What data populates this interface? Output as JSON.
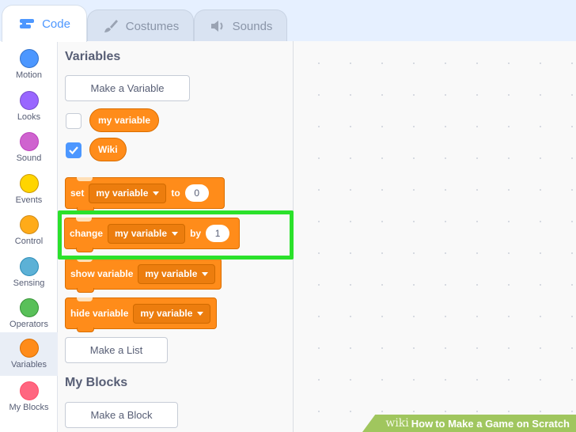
{
  "tabs": [
    {
      "label": "Code",
      "icon": "code-icon",
      "active": true
    },
    {
      "label": "Costumes",
      "icon": "brush-icon",
      "active": false
    },
    {
      "label": "Sounds",
      "icon": "speaker-icon",
      "active": false
    }
  ],
  "categories": [
    {
      "label": "Motion",
      "color": "#4c97ff"
    },
    {
      "label": "Looks",
      "color": "#9966ff"
    },
    {
      "label": "Sound",
      "color": "#cf63cf"
    },
    {
      "label": "Events",
      "color": "#ffd500"
    },
    {
      "label": "Control",
      "color": "#ffab19"
    },
    {
      "label": "Sensing",
      "color": "#5cb1d6"
    },
    {
      "label": "Operators",
      "color": "#59c059"
    },
    {
      "label": "Variables",
      "color": "#ff8c1a",
      "selected": true
    },
    {
      "label": "My Blocks",
      "color": "#ff6680"
    }
  ],
  "palette": {
    "variables_title": "Variables",
    "make_variable": "Make a Variable",
    "variables": [
      {
        "name": "my variable",
        "checked": false
      },
      {
        "name": "Wiki",
        "checked": true
      }
    ],
    "set_block": {
      "keyword": "set",
      "dropdown": "my variable",
      "to": "to",
      "value": "0"
    },
    "change_block": {
      "keyword": "change",
      "dropdown": "my variable",
      "by": "by",
      "value": "1"
    },
    "show_block": {
      "keyword": "show variable",
      "dropdown": "my variable"
    },
    "hide_block": {
      "keyword": "hide variable",
      "dropdown": "my variable"
    },
    "make_list": "Make a List",
    "myblocks_title": "My Blocks",
    "make_block": "Make a Block"
  },
  "watermark": {
    "wiki": "wiki",
    "how": "How",
    "rest": " to Make a Game on Scratch"
  },
  "colors": {
    "variables_orange": "#ff8c1a",
    "highlight_green": "#2be12b",
    "accent_blue": "#4c97ff"
  }
}
